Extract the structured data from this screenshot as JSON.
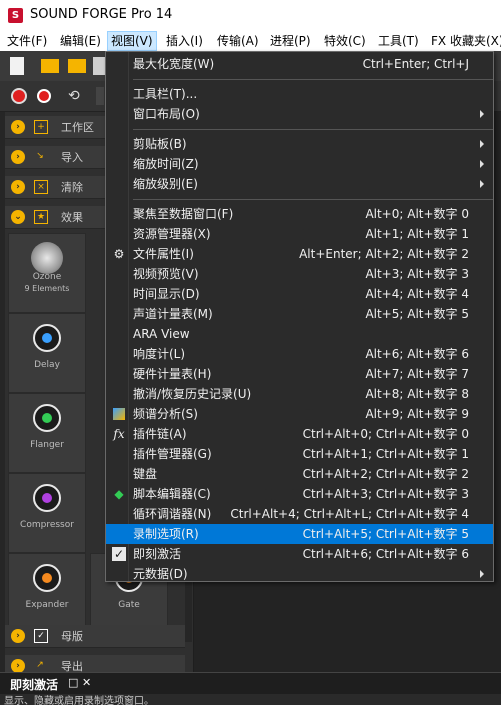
{
  "app": {
    "title": "SOUND FORGE Pro 14",
    "logo": "S"
  },
  "menubar": [
    {
      "label": "文件(F)"
    },
    {
      "label": "编辑(E)"
    },
    {
      "label": "视图(V)"
    },
    {
      "label": "插入(I)"
    },
    {
      "label": "传输(A)"
    },
    {
      "label": "进程(P)"
    },
    {
      "label": "特效(C)"
    },
    {
      "label": "工具(T)"
    },
    {
      "label": "FX 收藏夹(X)"
    }
  ],
  "leftpanel": {
    "categories": [
      {
        "label": "工作区",
        "icon": "plus-box-icon"
      },
      {
        "label": "导入",
        "icon": "import-icon"
      },
      {
        "label": "清除",
        "icon": "clean-icon"
      },
      {
        "label": "效果",
        "icon": "star-icon"
      },
      {
        "label": "母版",
        "icon": "check-box-icon"
      },
      {
        "label": "导出",
        "icon": "export-icon"
      }
    ],
    "plugins": [
      {
        "name": "Ozone",
        "sub": "9 Elements",
        "color": "#cccccc"
      },
      {
        "name": "Delay",
        "color": "#3aa0ff"
      },
      {
        "name": "Flanger",
        "color": "#33cc55"
      },
      {
        "name": "Compressor",
        "color": "#b040e0"
      },
      {
        "name": "Expander",
        "color": "#f58a1f"
      },
      {
        "name": "Gate",
        "color": "#f58a1f"
      }
    ]
  },
  "bottom": {
    "panel_title": "即刻激活",
    "status_text": "显示、隐藏或启用录制选项窗口。"
  },
  "menu": {
    "items": [
      {
        "label": "最大化宽度(W)",
        "shortcut": "Ctrl+Enter; Ctrl+J"
      },
      {
        "label": "工具栏(T)...",
        "shortcut": ""
      },
      {
        "label": "窗口布局(O)",
        "shortcut": "",
        "submenu": true
      },
      {
        "label": "剪贴板(B)",
        "shortcut": "",
        "submenu": true
      },
      {
        "label": "缩放时间(Z)",
        "shortcut": "",
        "submenu": true
      },
      {
        "label": "缩放级别(E)",
        "shortcut": "",
        "submenu": true
      },
      {
        "label": "聚焦至数据窗口(F)",
        "shortcut": "Alt+0; Alt+数字 0"
      },
      {
        "label": "资源管理器(X)",
        "shortcut": "Alt+1; Alt+数字 1"
      },
      {
        "label": "文件属性(I)",
        "shortcut": "Alt+Enter; Alt+2; Alt+数字 2",
        "icon": "gear-icon"
      },
      {
        "label": "视频预览(V)",
        "shortcut": "Alt+3; Alt+数字 3"
      },
      {
        "label": "时间显示(D)",
        "shortcut": "Alt+4; Alt+数字 4"
      },
      {
        "label": "声道计量表(M)",
        "shortcut": "Alt+5; Alt+数字 5"
      },
      {
        "label": "ARA View",
        "shortcut": ""
      },
      {
        "label": "响度计(L)",
        "shortcut": "Alt+6; Alt+数字 6"
      },
      {
        "label": "硬件计量表(H)",
        "shortcut": "Alt+7; Alt+数字 7"
      },
      {
        "label": "撤消/恢复历史记录(U)",
        "shortcut": "Alt+8; Alt+数字 8"
      },
      {
        "label": "频谱分析(S)",
        "shortcut": "Alt+9; Alt+数字 9",
        "icon": "spectrum-icon"
      },
      {
        "label": "插件链(A)",
        "shortcut": "Ctrl+Alt+0; Ctrl+Alt+数字 0",
        "icon": "fx-icon"
      },
      {
        "label": "插件管理器(G)",
        "shortcut": "Ctrl+Alt+1; Ctrl+Alt+数字 1"
      },
      {
        "label": "键盘",
        "shortcut": "Ctrl+Alt+2; Ctrl+Alt+数字 2"
      },
      {
        "label": "脚本编辑器(C)",
        "shortcut": "Ctrl+Alt+3; Ctrl+Alt+数字 3",
        "icon": "script-icon"
      },
      {
        "label": "循环调谐器(N)",
        "shortcut": "Ctrl+Alt+4; Ctrl+Alt+L; Ctrl+Alt+数字 4"
      },
      {
        "label": "录制选项(R)",
        "shortcut": "Ctrl+Alt+5; Ctrl+Alt+数字 5",
        "highlighted": true
      },
      {
        "label": "即刻激活",
        "shortcut": "Ctrl+Alt+6; Ctrl+Alt+数字 6",
        "checked": true
      },
      {
        "label": "元数据(D)",
        "shortcut": "",
        "submenu": true
      }
    ]
  },
  "colors": {
    "highlight": "#0078d7",
    "accent": "#f5b400",
    "brand": "#c8102e"
  }
}
